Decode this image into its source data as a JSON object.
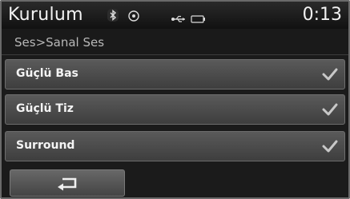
{
  "header": {
    "title": "Kurulum",
    "clock": "0:13",
    "icons": [
      "bluetooth-icon",
      "disc-icon",
      "usb-icon",
      "battery-icon"
    ]
  },
  "breadcrumb": "Ses>Sanal Ses",
  "options": [
    {
      "label": "Güçlü Bas",
      "checked": true
    },
    {
      "label": "Güçlü Tiz",
      "checked": true
    },
    {
      "label": "Surround",
      "checked": true
    }
  ],
  "footer": {
    "back_icon": "back-arrow-icon"
  },
  "colors": {
    "background": "#1b1b1b",
    "row": "#4a4a4a",
    "text": "#f4f4f4",
    "check": "#c8c8c8"
  }
}
